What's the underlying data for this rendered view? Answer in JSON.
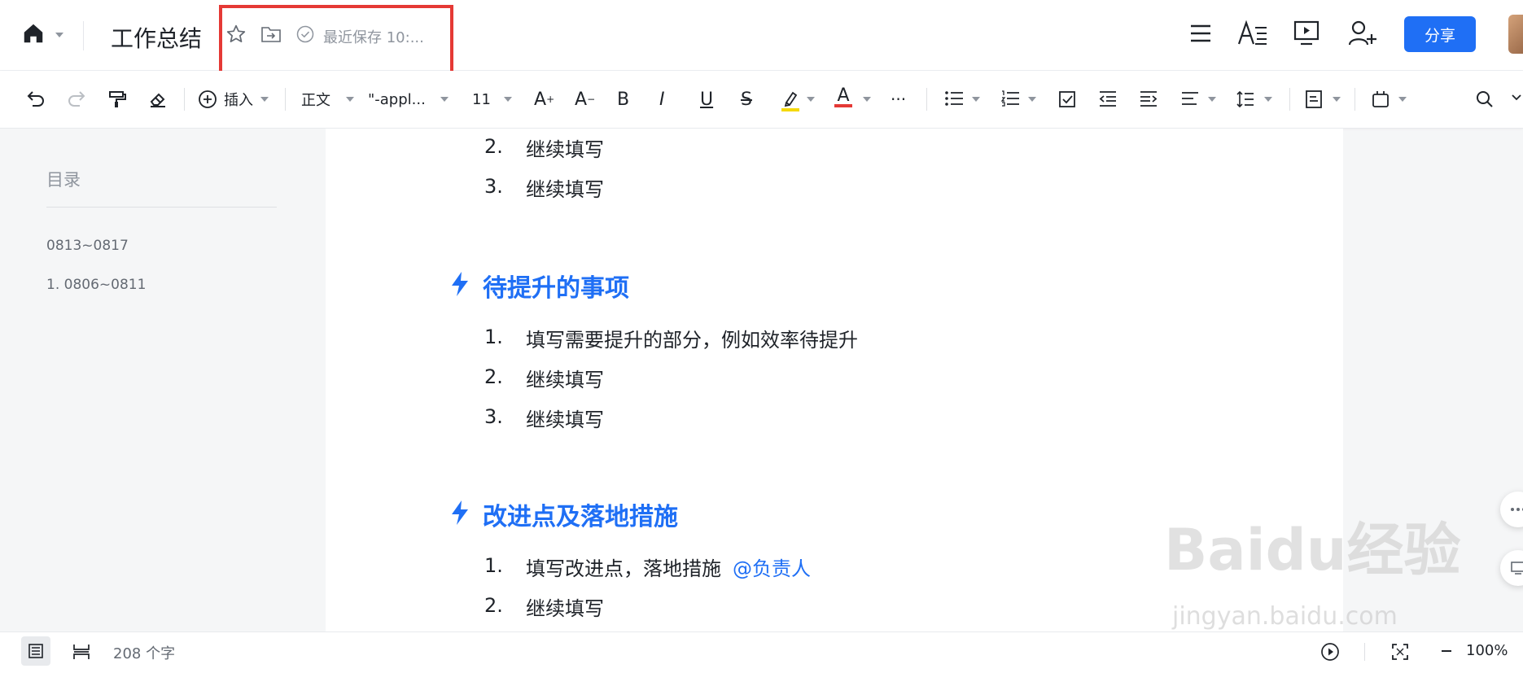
{
  "header": {
    "title": "工作总结",
    "save_status": "最近保存 10:...",
    "share_label": "分享"
  },
  "toolbar": {
    "insert_label": "插入",
    "style_label": "正文",
    "font_label": "\"-appl...",
    "size_label": "11",
    "bold_label": "B",
    "italic_label": "I",
    "underline_label": "U",
    "strike_label": "S",
    "fontcolor_label": "A",
    "more_label": "···",
    "grow_label": "A",
    "shrink_label": "A",
    "highlight_color": "#f5d90a",
    "fontcolor_color": "#e53935"
  },
  "sidebar": {
    "title": "目录",
    "items": [
      {
        "label": "0813~0817"
      },
      {
        "label": "1. 0806~0811"
      }
    ]
  },
  "content": {
    "list_top": [
      {
        "num": "2.",
        "text": "继续填写"
      },
      {
        "num": "3.",
        "text": "继续填写"
      }
    ],
    "section1": {
      "heading": "待提升的事项",
      "items": [
        {
          "num": "1.",
          "text": "填写需要提升的部分，例如效率待提升"
        },
        {
          "num": "2.",
          "text": "继续填写"
        },
        {
          "num": "3.",
          "text": "继续填写"
        }
      ]
    },
    "section2": {
      "heading": "改进点及落地措施",
      "items": [
        {
          "num": "1.",
          "text": "填写改进点，落地措施",
          "mention": "@负责人"
        },
        {
          "num": "2.",
          "text": "继续填写"
        }
      ]
    }
  },
  "statusbar": {
    "word_count": "208 个字",
    "zoom": "100%"
  },
  "watermark": {
    "main": "Baidu经验",
    "sub": "jingyan.baidu.com"
  },
  "colors": {
    "accent": "#1f6ff5",
    "highlight": "#e53935"
  }
}
